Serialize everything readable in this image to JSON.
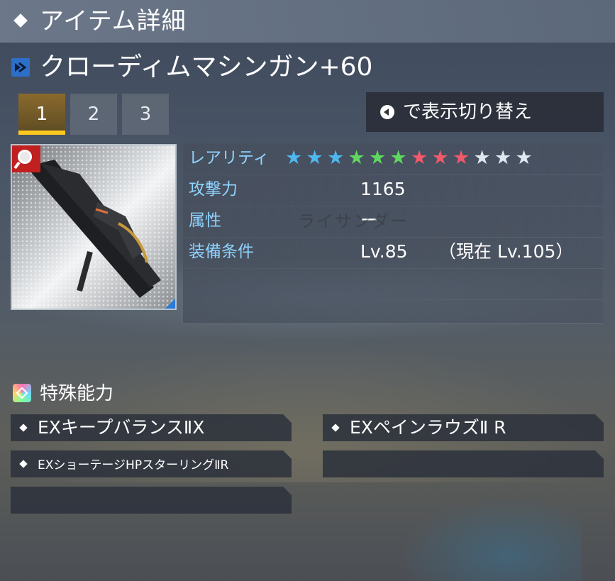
{
  "header": {
    "title": "アイテム詳細"
  },
  "item": {
    "name": "クローディムマシンガン+60",
    "icon": "twin-machine-gun-icon"
  },
  "tabs": [
    {
      "label": "1",
      "active": true
    },
    {
      "label": "2",
      "active": false
    },
    {
      "label": "3",
      "active": false
    }
  ],
  "toggle": {
    "label": "で表示切り替え",
    "icon": "left-button-icon"
  },
  "stats": {
    "rarity_label": "レアリティ",
    "rarity_stars": 12,
    "star_colors": [
      "#4fb8f0",
      "#4fb8f0",
      "#4fb8f0",
      "#5fd860",
      "#5fd860",
      "#5fd860",
      "#f05a6a",
      "#f05a6a",
      "#f05a6a",
      "#dfe8f0",
      "#dfe8f0",
      "#dfe8f0"
    ],
    "attack_label": "攻撃力",
    "attack_value": "1165",
    "element_label": "属性",
    "element_value": "ー",
    "element_watermark": "ライサンダー",
    "requirement_label": "装備条件",
    "requirement_value": "Lv.85",
    "current_level": "（現在  Lv.105）"
  },
  "special": {
    "title": "特殊能力",
    "abilities": [
      "EXキープバランスⅡX",
      "EXペインラウズⅡ R",
      "EXショーテージHPスターリングⅡR",
      "",
      ""
    ]
  },
  "colors": {
    "accent_tab": "#ffc81e",
    "label_blue": "#8fd3ff"
  }
}
